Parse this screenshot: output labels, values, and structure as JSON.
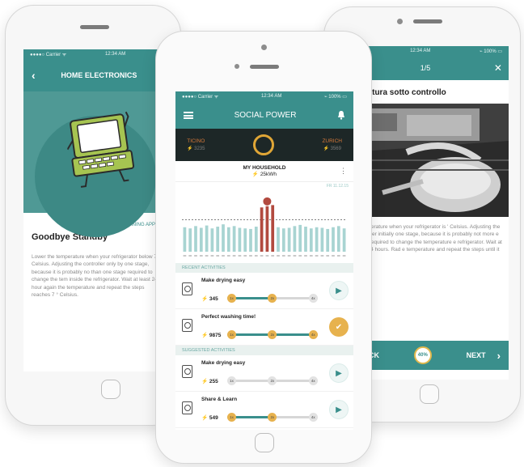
{
  "left": {
    "status": {
      "carrier": "●●●●○ Carrier ᯤ",
      "time": "12:34 AM"
    },
    "header": {
      "back": "‹",
      "title": "HOME ELECTRONICS"
    },
    "category": "CLEANING APPLIA",
    "title": "Goodbye Standby",
    "body": "Lower the temperature when your refrigerator below 7 ° Celsius. Adjusting the controller only by one stage, because it is probably no than one stage required to change the tem inside the refrigerator. Wait at least 24 hour again the temperature and repeat the steps reaches 7 ° Celsius."
  },
  "center": {
    "status": {
      "carrier": "●●●●○ Carrier ᯤ",
      "time": "12:34 AM",
      "battery": "⌁ 100% ▭"
    },
    "header": {
      "title": "SOCIAL POWER"
    },
    "score": {
      "left_label": "TICINO",
      "left_value": "⚡ 3235",
      "right_label": "ZURICH",
      "right_value": "⚡ 3569"
    },
    "household": {
      "label": "MY HOUSEHOLD",
      "value": "⚡ 25kWh",
      "menu": "⋮"
    },
    "chart_date": "FR 11.12.15",
    "recent_label": "RECENT ACTIVITIES",
    "suggested_label": "SUGGESTED ACTIVITIES",
    "recent": [
      {
        "name": "Make drying easy",
        "points": "⚡ 345",
        "progress": 0.5,
        "marks": [
          "1x",
          "2x",
          "4x"
        ],
        "action": "▶"
      },
      {
        "name": "Perfect washing time!",
        "points": "⚡ 9875",
        "progress": 1.0,
        "marks": [
          "1x",
          "2x",
          "4x"
        ],
        "action": "✔"
      }
    ],
    "suggested": [
      {
        "name": "Make drying easy",
        "points": "⚡ 255",
        "progress": 0.0,
        "marks": [
          "1x",
          "2x",
          "4x"
        ],
        "action": "▶"
      },
      {
        "name": "Share & Learn",
        "points": "⚡ 549",
        "progress": 0.5,
        "marks": [
          "1x",
          "2x",
          "4x"
        ],
        "action": "▶"
      }
    ],
    "chart_data": {
      "type": "bar",
      "values": [
        42,
        40,
        44,
        41,
        45,
        40,
        43,
        47,
        42,
        44,
        41,
        40,
        39,
        43,
        76,
        78,
        80,
        42,
        40,
        41,
        44,
        46,
        43,
        40,
        42,
        41,
        39,
        42,
        44,
        40
      ],
      "highlight": [
        14,
        15,
        16
      ],
      "average": 55,
      "colors": {
        "normal": "#a8d4d2",
        "highlight": "#b24a3f"
      }
    }
  },
  "right": {
    "status": {
      "carrier": "ᯤ",
      "time": "12:34 AM",
      "battery": "⌁ 100% ▭"
    },
    "header": {
      "page": "1/5",
      "close": "✕"
    },
    "title": "peratura sotto controllo",
    "body": "e temperature when your refrigerator is ' Celsius. Adjusting the controller initially one stage, because it is probably not more e stage required to change the temperature e refrigerator. Wait at least 24 hours. Rad e temperature and repeat the steps until it",
    "footer": {
      "back": "BACK",
      "progress": "40%",
      "next": "NEXT",
      "chev": "›"
    }
  },
  "colors": {
    "teal": "#3a8f8c",
    "accent": "#e7b24e",
    "bar_highlight": "#b24a3f",
    "dark": "#1d2727"
  }
}
